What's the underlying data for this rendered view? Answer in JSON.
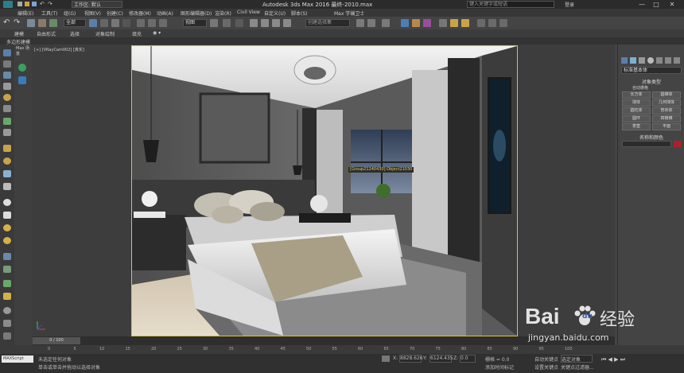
{
  "titlebar": {
    "workspace": "工作区: 默认",
    "app_title": "Autodesk 3ds Max 2016    最终-2010.max",
    "search_placeholder": "键入关键字或短语",
    "user": "登录",
    "min": "—",
    "max": "□",
    "close": "✕"
  },
  "menu": [
    "编辑(E)",
    "工具(T)",
    "组(G)",
    "视图(V)",
    "创建(C)",
    "修改器(M)",
    "动画(A)",
    "图形编辑器(D)",
    "渲染(R)",
    "Civil View",
    "自定义(U)",
    "脚本(S)",
    "Max 学编卫士"
  ],
  "toolbar": {
    "filter": "全部",
    "view": "视图",
    "named_set": "创建选择集"
  },
  "ribbon": {
    "tabs": [
      "建模",
      "自由形式",
      "选择",
      "对象绘制",
      "填充"
    ],
    "sub": "多边形建模"
  },
  "explorer": {
    "label": "Max 场景"
  },
  "viewport": {
    "label": "[+] [VRayCam002] [真实]",
    "tooltip": "[Group21240430] Object21030"
  },
  "cmdpanel": {
    "dropdown": "标准基本体",
    "section1": "对象类型",
    "autogrid": "自动栅格",
    "buttons": [
      "长方体",
      "圆锥体",
      "球体",
      "几何球体",
      "圆柱体",
      "管状体",
      "圆环",
      "四棱锥",
      "茶壶",
      "平面"
    ],
    "section2": "名称和颜色",
    "accent_color": "#a8232c"
  },
  "timeline": {
    "frame": "0 / 100",
    "ticks": [
      "0",
      "5",
      "10",
      "15",
      "20",
      "25",
      "30",
      "35",
      "40",
      "45",
      "50",
      "55",
      "60",
      "65",
      "70",
      "75",
      "80",
      "85",
      "90",
      "95",
      "100"
    ]
  },
  "status": {
    "script": "MAXScript",
    "line1": "未选定任何对象",
    "line2": "单击或单击并拖动以选择对象",
    "x_label": "X:",
    "x_val": "8828.626",
    "y_label": "Y:",
    "y_val": "6124.435",
    "z_label": "Z:",
    "z_val": "0.0",
    "grid": "栅格 = 0.0",
    "autokey": "自动关键点",
    "selected": "选定对象",
    "setkey": "设置关键点",
    "keyfilter": "关键点过滤器...",
    "addtime": "添加时间标记"
  },
  "watermark": {
    "brand": "Bai",
    "paw": "du",
    "cn": "经验",
    "url": "jingyan.baidu.com"
  }
}
